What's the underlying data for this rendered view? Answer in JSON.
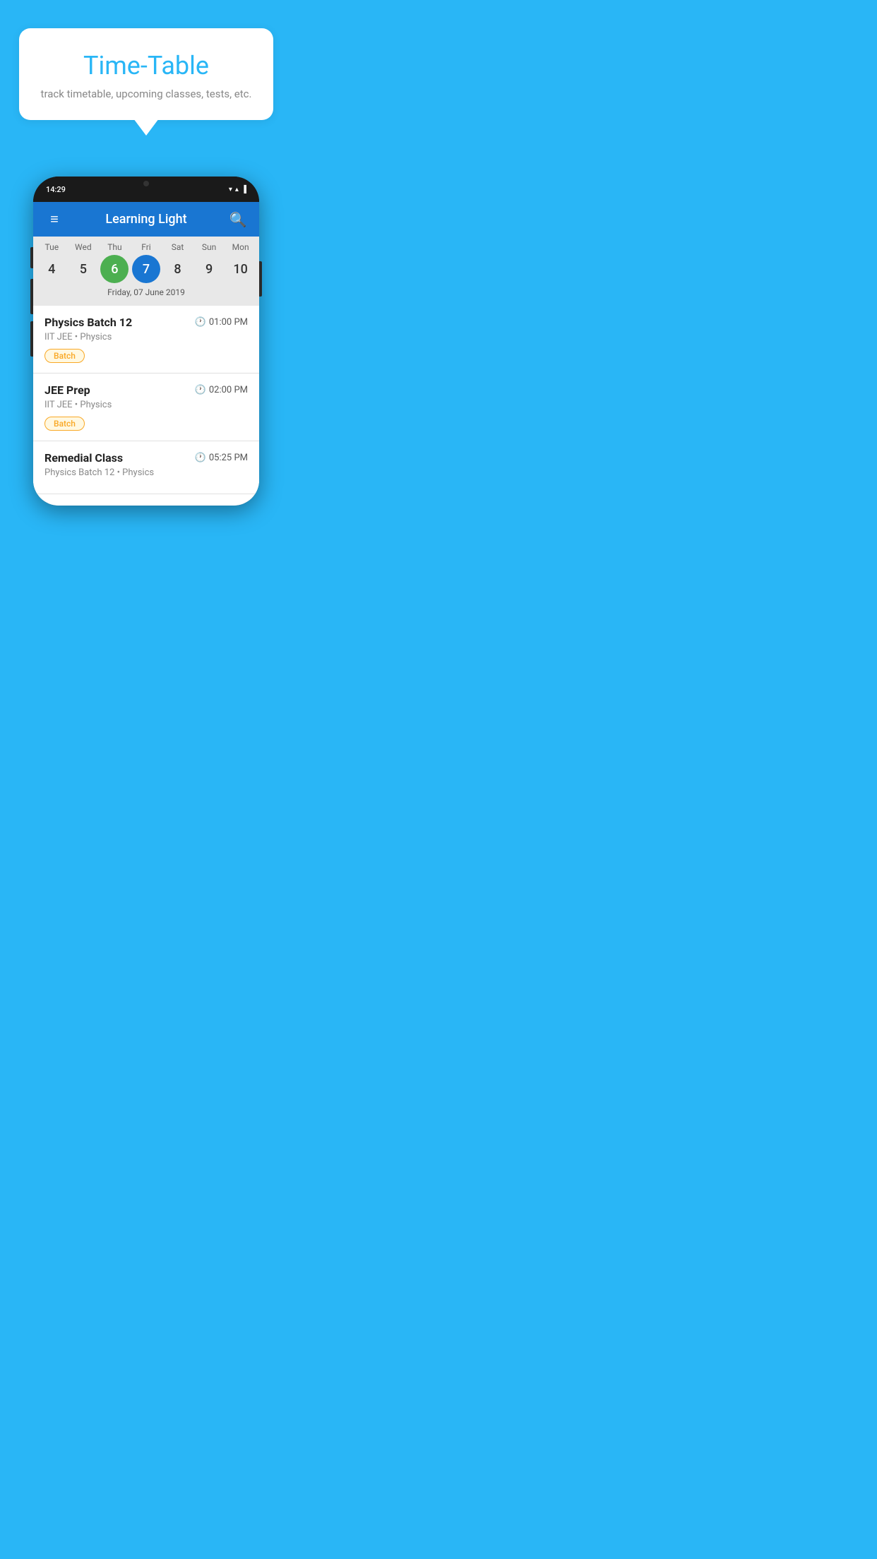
{
  "background_color": "#29B6F6",
  "speech_bubble": {
    "title": "Time-Table",
    "subtitle": "track timetable, upcoming classes, tests, etc."
  },
  "phone": {
    "status_bar": {
      "time": "14:29",
      "wifi_icon": "▼",
      "signal_icon": "▲",
      "battery_icon": "▐"
    },
    "app_bar": {
      "title": "Learning Light",
      "hamburger_label": "≡",
      "search_label": "🔍"
    },
    "calendar": {
      "days": [
        {
          "label": "Tue",
          "number": "4",
          "state": "normal"
        },
        {
          "label": "Wed",
          "number": "5",
          "state": "normal"
        },
        {
          "label": "Thu",
          "number": "6",
          "state": "today"
        },
        {
          "label": "Fri",
          "number": "7",
          "state": "selected"
        },
        {
          "label": "Sat",
          "number": "8",
          "state": "normal"
        },
        {
          "label": "Sun",
          "number": "9",
          "state": "normal"
        },
        {
          "label": "Mon",
          "number": "10",
          "state": "normal"
        }
      ],
      "selected_date_label": "Friday, 07 June 2019"
    },
    "schedule": [
      {
        "title": "Physics Batch 12",
        "time": "01:00 PM",
        "subtitle": "IIT JEE • Physics",
        "badge": "Batch"
      },
      {
        "title": "JEE Prep",
        "time": "02:00 PM",
        "subtitle": "IIT JEE • Physics",
        "badge": "Batch"
      },
      {
        "title": "Remedial Class",
        "time": "05:25 PM",
        "subtitle": "Physics Batch 12 • Physics",
        "badge": null
      }
    ]
  }
}
